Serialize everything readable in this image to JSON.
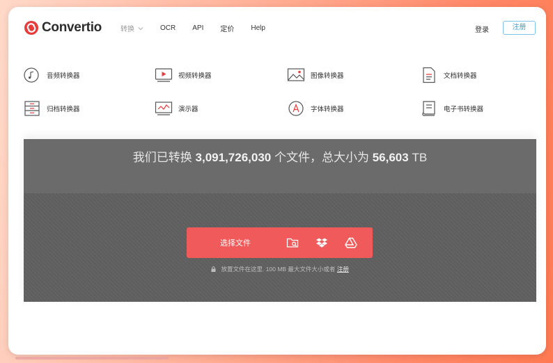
{
  "brand": {
    "name": "Convertio",
    "color": "#e83b3b"
  },
  "nav": {
    "items": [
      {
        "label": "转换",
        "has_dropdown": true
      },
      {
        "label": "OCR"
      },
      {
        "label": "API"
      },
      {
        "label": "定价"
      },
      {
        "label": "Help"
      }
    ],
    "login": "登录",
    "register": "注册"
  },
  "converters": [
    {
      "label": "音频转换器",
      "icon": "music-note-icon"
    },
    {
      "label": "视频转换器",
      "icon": "video-player-icon"
    },
    {
      "label": "图像转换器",
      "icon": "image-icon"
    },
    {
      "label": "文档转换器",
      "icon": "document-icon"
    },
    {
      "label": "归档转换器",
      "icon": "archive-icon"
    },
    {
      "label": "演示器",
      "icon": "presentation-icon"
    },
    {
      "label": "字体转换器",
      "icon": "font-icon"
    },
    {
      "label": "电子书转换器",
      "icon": "ebook-icon"
    }
  ],
  "hero": {
    "stats_prefix": "我们已转换",
    "files_count": "3,091,726,030",
    "stats_middle": "个文件，总大小为",
    "total_size": "56,603",
    "size_unit": "TB"
  },
  "upload": {
    "button_label": "选择文件",
    "sources": [
      "folder-search-icon",
      "dropbox-icon",
      "google-drive-icon"
    ],
    "accent": "#f05a5a"
  },
  "hint": {
    "text": "放置文件在这里. 100 MB 最大文件大小或者",
    "link": "注册"
  }
}
